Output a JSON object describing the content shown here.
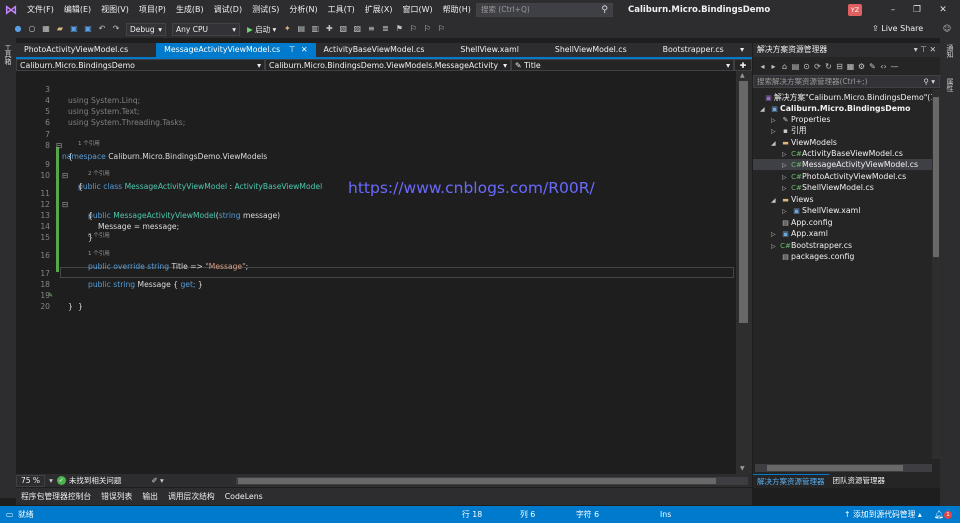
{
  "menu": {
    "items": [
      "文件(F)",
      "编辑(E)",
      "视图(V)",
      "项目(P)",
      "生成(B)",
      "调试(D)",
      "测试(S)",
      "分析(N)",
      "工具(T)",
      "扩展(X)",
      "窗口(W)",
      "帮助(H)"
    ],
    "search_placeholder": "搜索 (Ctrl+Q)",
    "app_title": "Caliburn.Micro.BindingsDemo",
    "avatar_initials": "YZ"
  },
  "toolbar": {
    "config": "Debug",
    "platform": "Any CPU",
    "start_label": "启动",
    "live_share": "Live Share"
  },
  "left_strip": {
    "label": "工具箱"
  },
  "tabs": [
    {
      "label": "PhotoActivityViewModel.cs",
      "active": false
    },
    {
      "label": "MessageActivityViewModel.cs",
      "active": true
    },
    {
      "label": "ActivityBaseViewModel.cs",
      "active": false
    },
    {
      "label": "ShellView.xaml",
      "active": false
    },
    {
      "label": "ShellViewModel.cs",
      "active": false
    },
    {
      "label": "Bootstrapper.cs",
      "active": false
    }
  ],
  "navbar": {
    "project": "Caliburn.Micro.BindingsDemo",
    "type": "Caliburn.Micro.BindingsDemo.ViewModels.MessageActivity",
    "member": "Title"
  },
  "code": {
    "line_numbers": [
      "3",
      "4",
      "5",
      "6",
      "7",
      "8",
      "9",
      "10",
      "11",
      "12",
      "13",
      "14",
      "15",
      "16",
      "17",
      "18",
      "19",
      "20"
    ],
    "using_kw": "using",
    "using_linq": "System.Linq;",
    "using_text": "System.Text;",
    "using_tasks": "System.Threading.Tasks;",
    "namespace_kw": "namespace",
    "namespace_name": "Caliburn.Micro.BindingsDemo.ViewModels",
    "brace_open": "{",
    "brace_close": "}",
    "lens_1": "1 个引用",
    "lens_2": "2 个引用",
    "lens_3": "0 个引用",
    "lens_4": "1 个引用",
    "public_kw": "public",
    "class_kw": "class",
    "class_name": "MessageActivityViewModel",
    "colon": ":",
    "base_class": "ActivityBaseViewModel",
    "ctor_name": "MessageActivityViewModel",
    "ctor_params_open": "(",
    "string_kw": "string",
    "param_name": "message)",
    "assign": "Message = message;",
    "override_kw": "override",
    "title_prop": "Title =>",
    "title_value": "\"Message\"",
    "semicolon": ";",
    "message_prop": "Message {",
    "get_kw": "get;",
    "prop_close": "}"
  },
  "watermark": "https://www.cnblogs.com/R00R/",
  "editor_status": {
    "zoom": "75 %",
    "issues": "未找到相关问题"
  },
  "bottom_tabs": [
    "程序包管理器控制台",
    "错误列表",
    "输出",
    "调用层次结构",
    "CodeLens"
  ],
  "statusbar": {
    "ready": "就绪",
    "line": "行 18",
    "col": "列 6",
    "char": "字符 6",
    "ins": "Ins",
    "add_source": "↑ 添加到源代码管理 ▴",
    "notify_count": "1"
  },
  "solution_explorer": {
    "title": "解决方案资源管理器",
    "search_placeholder": "搜索解决方案资源管理器(Ctrl+;)",
    "solution_label": "解决方案\"Caliburn.Micro.BindingsDemo\"(1 个项目",
    "project": "Caliburn.Micro.BindingsDemo",
    "items": {
      "properties": "Properties",
      "references": "引用",
      "viewmodels": "ViewModels",
      "activity_base": "ActivityBaseViewModel.cs",
      "message_activity": "MessageActivityViewModel.cs",
      "photo_activity": "PhotoActivityViewModel.cs",
      "shell_vm": "ShellViewModel.cs",
      "views": "Views",
      "shell_view": "ShellView.xaml",
      "app_config": "App.config",
      "app_xaml": "App.xaml",
      "bootstrapper": "Bootstrapper.cs",
      "packages": "packages.config"
    },
    "tab_solution": "解决方案资源管理器",
    "tab_team": "团队资源管理器"
  },
  "right_strip": {
    "label_1": "通知",
    "label_2": "属性"
  }
}
